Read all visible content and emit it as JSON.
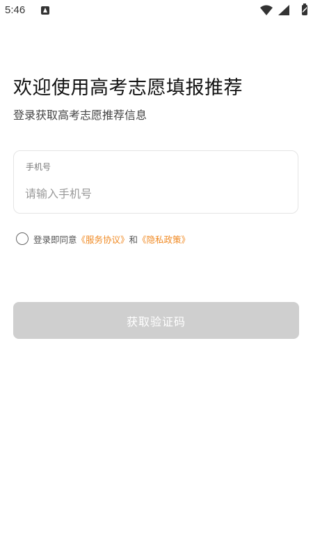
{
  "status_bar": {
    "time": "5:46",
    "icons": [
      "notification-icon",
      "wifi-icon",
      "signal-icon",
      "battery-icon"
    ]
  },
  "header": {
    "title": "欢迎使用高考志愿填报推荐",
    "subtitle": "登录获取高考志愿推荐信息"
  },
  "phone_field": {
    "label": "手机号",
    "placeholder": "请输入手机号",
    "value": ""
  },
  "agreement": {
    "checked": false,
    "prefix": "登录即同意",
    "service_link": "《服务协议》",
    "conjunction": "和",
    "privacy_link": "《隐私政策》"
  },
  "actions": {
    "get_code_label": "获取验证码"
  },
  "colors": {
    "link": "#f08a24",
    "button_disabled": "#cfcfcf"
  }
}
